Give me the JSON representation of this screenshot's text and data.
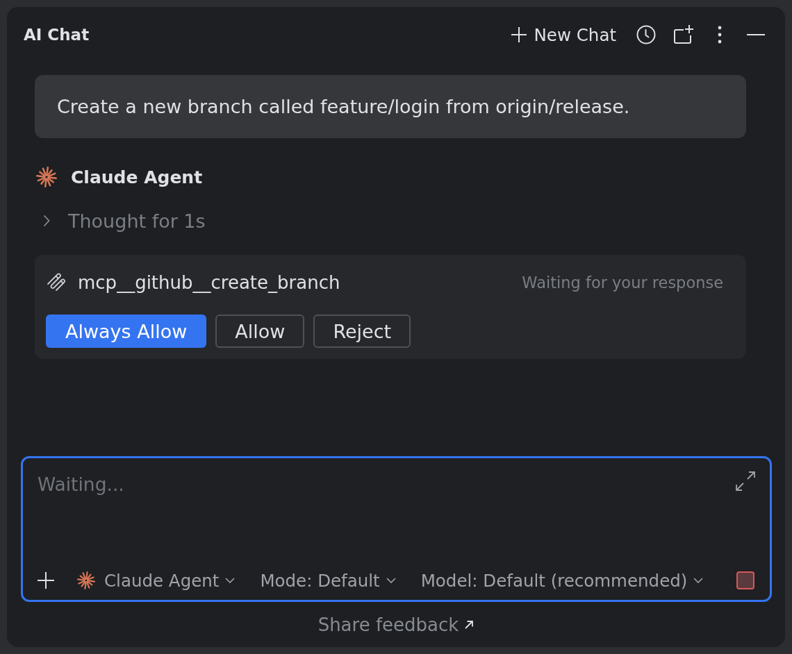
{
  "header": {
    "title": "AI Chat",
    "new_chat": "New Chat"
  },
  "messages": [
    {
      "kind": "user",
      "text": "Create a new branch called feature/login from origin/release."
    },
    {
      "kind": "agent",
      "name": "Claude Agent",
      "thought": {
        "label": "Thought for 1s",
        "expanded": false
      },
      "tool_call": {
        "name": "mcp__github__create_branch",
        "status": "Waiting for your response",
        "buttons": [
          {
            "label": "Always Allow",
            "primary": true
          },
          {
            "label": "Allow",
            "primary": false
          },
          {
            "label": "Reject",
            "primary": false
          }
        ]
      }
    }
  ],
  "composer": {
    "placeholder": "Waiting...",
    "focused": true,
    "agent": "Claude Agent",
    "mode": "Mode: Default",
    "model": "Model: Default (recommended)"
  },
  "footer": {
    "link": "Share feedback"
  }
}
